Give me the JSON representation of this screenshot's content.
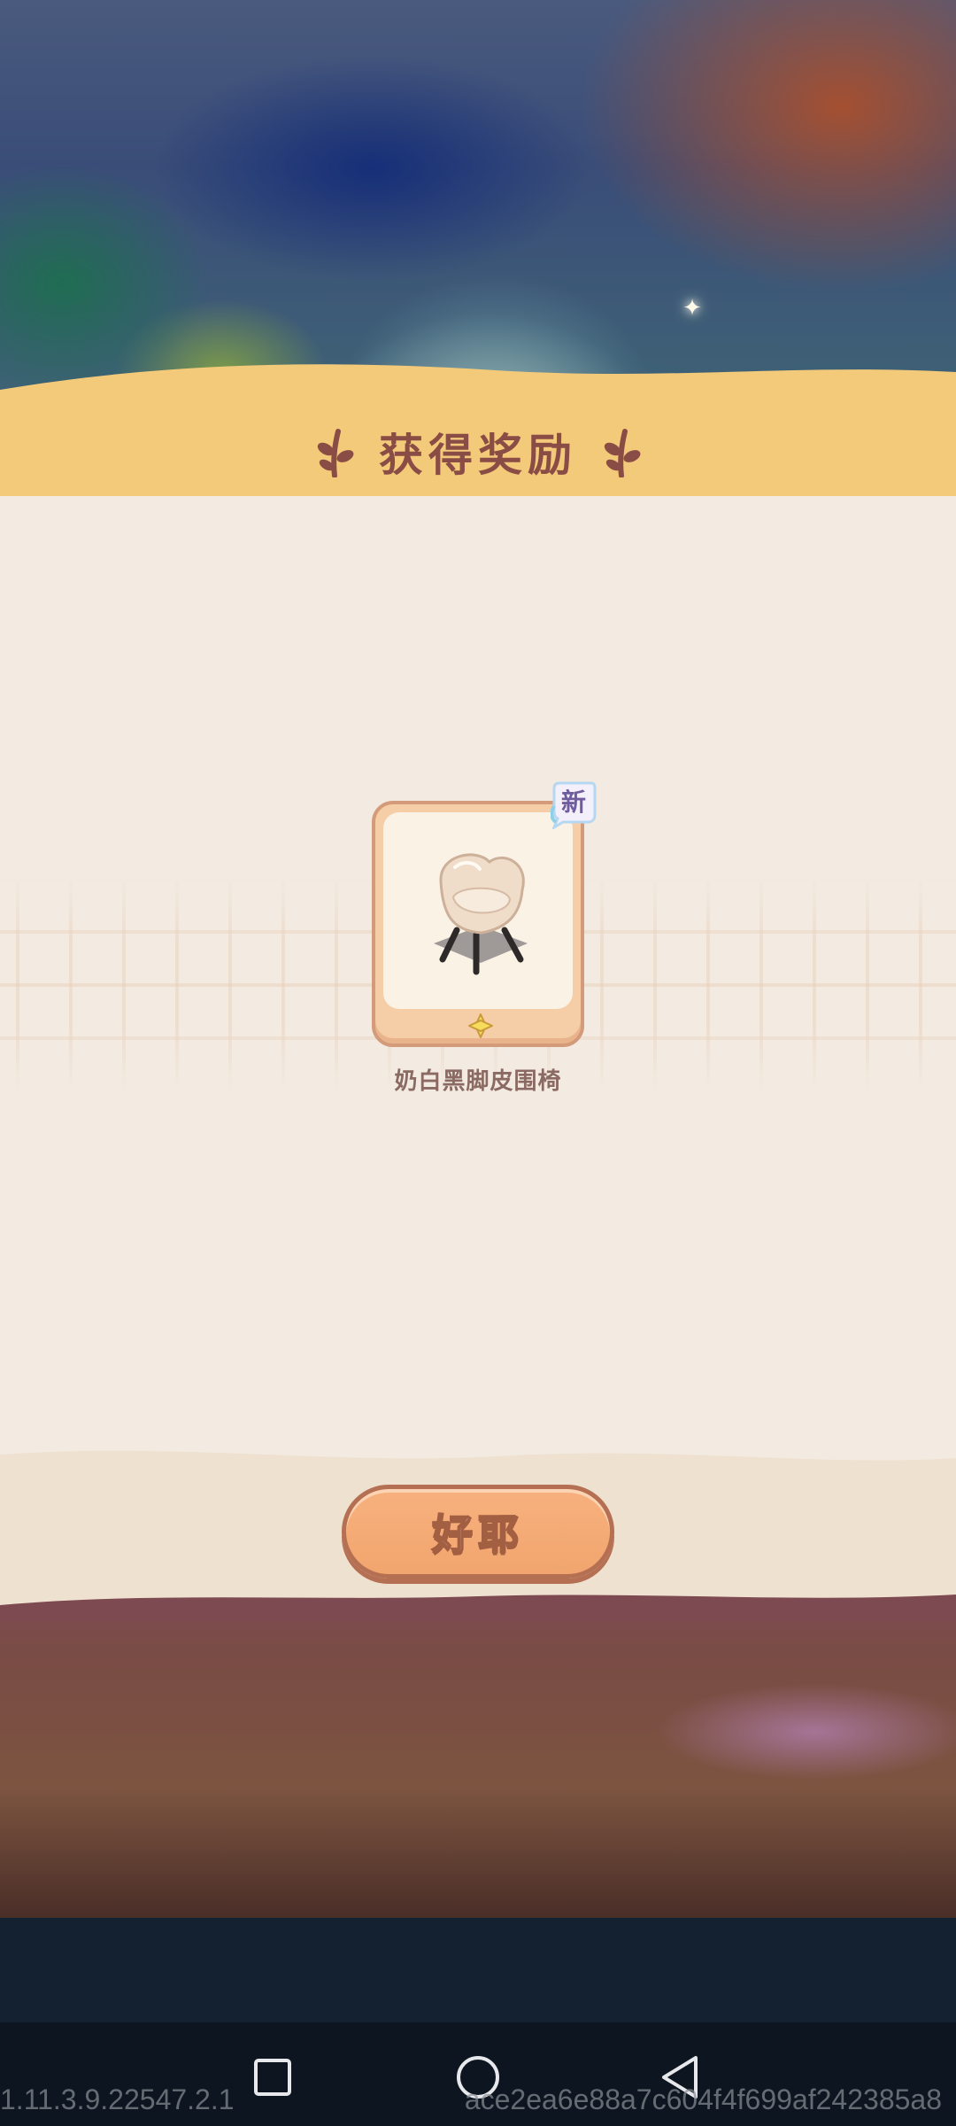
{
  "reward_panel": {
    "title": "获得奖励",
    "items": [
      {
        "name": "奶白黑脚皮围椅",
        "badge": "新",
        "image": "cream-armchair-icon",
        "rarity_icon": "yellow-star-icon"
      }
    ],
    "confirm_label": "好耶"
  },
  "system": {
    "nav": [
      "recents-square-icon",
      "home-circle-icon",
      "back-triangle-icon"
    ],
    "version": "1.11.3.9.22547.2.1",
    "build_hash": "ace2ea6e88a7c604f4f699af242385a8"
  },
  "colors": {
    "header_yellow": "#f3c97a",
    "panel_cream": "#f3ebe1",
    "title_brown": "#8a4d45",
    "button_orange": "#f4a873"
  }
}
